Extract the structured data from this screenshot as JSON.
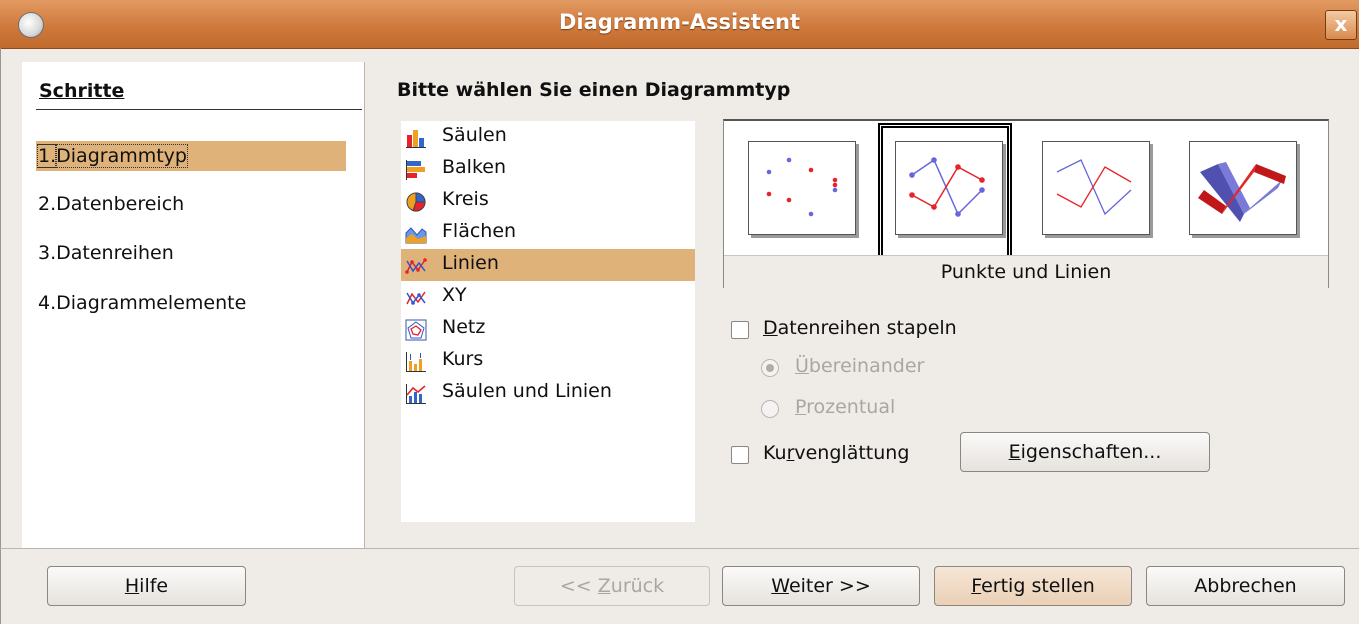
{
  "window": {
    "title": "Diagramm-Assistent",
    "close_glyph": "x"
  },
  "steps": {
    "title": "Schritte",
    "items": [
      {
        "num": "1.",
        "label": "Diagrammtyp",
        "selected": true
      },
      {
        "num": "2.",
        "label": "Datenbereich"
      },
      {
        "num": "3.",
        "label": "Datenreihen"
      },
      {
        "num": "4.",
        "label": "Diagrammelemente"
      }
    ]
  },
  "main": {
    "heading": "Bitte wählen Sie einen Diagrammtyp",
    "types": [
      {
        "label": "Säulen",
        "icon": "column-chart-icon"
      },
      {
        "label": "Balken",
        "icon": "bar-chart-icon"
      },
      {
        "label": "Kreis",
        "icon": "pie-chart-icon"
      },
      {
        "label": "Flächen",
        "icon": "area-chart-icon"
      },
      {
        "label": "Linien",
        "icon": "line-chart-icon",
        "selected": true
      },
      {
        "label": "XY",
        "icon": "xy-chart-icon"
      },
      {
        "label": "Netz",
        "icon": "net-chart-icon"
      },
      {
        "label": "Kurs",
        "icon": "stock-chart-icon"
      },
      {
        "label": "Säulen und Linien",
        "icon": "column-line-chart-icon"
      }
    ],
    "variant_caption": "Punkte und Linien",
    "stack": {
      "pre": "",
      "key": "D",
      "post": "atenreihen stapeln",
      "checked": false
    },
    "stack_opt1": {
      "pre": "",
      "key": "Ü",
      "post": "bereinander",
      "selected": true
    },
    "stack_opt2": {
      "pre": "",
      "key": "P",
      "post": "rozentual",
      "selected": false
    },
    "smooth": {
      "pre": "Ku",
      "key": "r",
      "post": "venglättung",
      "checked": false
    },
    "properties": {
      "pre": "",
      "key": "E",
      "post": "igenschaften..."
    }
  },
  "buttons": {
    "help": {
      "pre": "",
      "key": "H",
      "post": "ilfe"
    },
    "back": {
      "pre": "<< ",
      "key": "Z",
      "post": "urück"
    },
    "next": {
      "pre": "",
      "key": "W",
      "post": "eiter >>"
    },
    "finish": {
      "pre": "",
      "key": "F",
      "post": "ertig stellen"
    },
    "cancel": {
      "pre": "",
      "key": "",
      "post": "Abbrechen"
    }
  },
  "colors": {
    "accent": "#dfb27a",
    "titlebar": "#cf7a3d",
    "series_red": "#e8222a",
    "series_blue": "#6666dd"
  }
}
